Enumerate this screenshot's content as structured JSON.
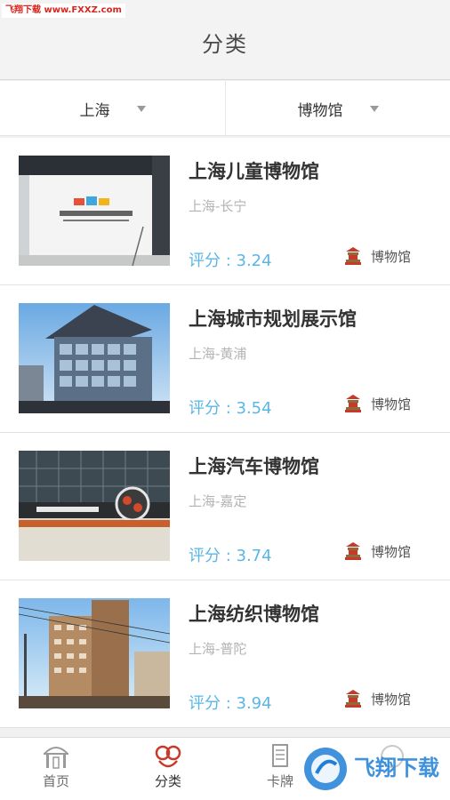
{
  "watermark_top": "飞翔下载 www.FXXZ.com",
  "header": {
    "title": "分类"
  },
  "filters": [
    {
      "label": "上海"
    },
    {
      "label": "博物馆"
    }
  ],
  "items": [
    {
      "name": "上海儿童博物馆",
      "location": "上海-长宁",
      "score": "评分 : 3.24",
      "category": "博物馆"
    },
    {
      "name": "上海城市规划展示馆",
      "location": "上海-黄浦",
      "score": "评分 : 3.54",
      "category": "博物馆"
    },
    {
      "name": "上海汽车博物馆",
      "location": "上海-嘉定",
      "score": "评分 : 3.74",
      "category": "博物馆"
    },
    {
      "name": "上海纺织博物馆",
      "location": "上海-普陀",
      "score": "评分 : 3.94",
      "category": "博物馆"
    }
  ],
  "tabbar": {
    "tabs": [
      {
        "label": "首页",
        "icon": "home-arch-icon"
      },
      {
        "label": "分类",
        "icon": "category-icon"
      },
      {
        "label": "卡牌",
        "icon": "card-icon"
      },
      {
        "label": "",
        "icon": "profile-icon"
      }
    ]
  },
  "watermark_bottom": "飞翔下载",
  "colors": {
    "accent_blue": "#5ab6e6",
    "active_tab_red": "#c8392b",
    "watermark_red": "#d8261e"
  }
}
